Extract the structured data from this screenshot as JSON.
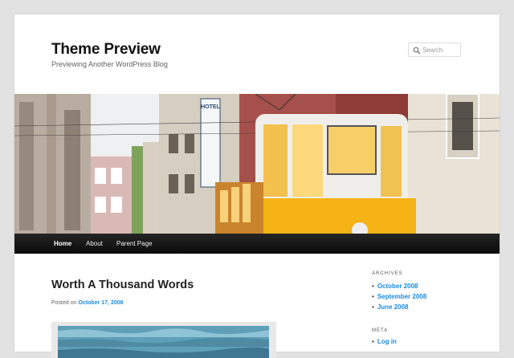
{
  "site": {
    "title": "Theme Preview",
    "description": "Previewing Another WordPress Blog"
  },
  "search": {
    "placeholder": "Search",
    "icon": "search-icon"
  },
  "header_image": {
    "sign_text": "HOTEL BUICO ATLANTICO"
  },
  "nav": {
    "items": [
      {
        "label": "Home",
        "current": true
      },
      {
        "label": "About",
        "current": false
      },
      {
        "label": "Parent Page",
        "current": false
      }
    ]
  },
  "post": {
    "title": "Worth A Thousand Words",
    "posted_on_label": "Posted on",
    "date": "October 17, 2008"
  },
  "sidebar": {
    "archives_title": "ARCHIVES",
    "archives": [
      "October 2008",
      "September 2008",
      "June 2008"
    ],
    "meta_title": "META",
    "meta_items": [
      "Log in"
    ]
  },
  "colors": {
    "link": "#1b8be0",
    "background": "#e2e2e2",
    "nav_bg": "#111111",
    "tram_yellow": "#f5b316"
  }
}
